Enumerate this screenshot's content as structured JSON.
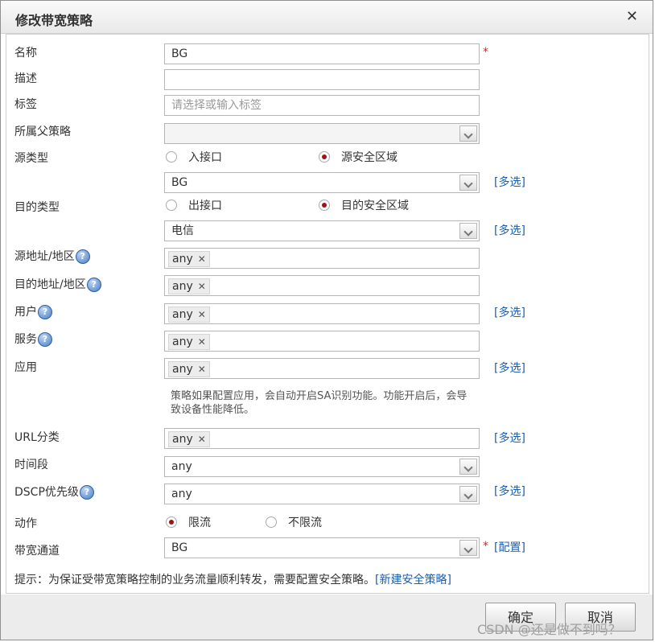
{
  "dialog": {
    "title": "修改带宽策略",
    "close_symbol": "✕"
  },
  "fields": {
    "name": {
      "label": "名称",
      "value": "BG",
      "required_mark": "*"
    },
    "description": {
      "label": "描述",
      "value": ""
    },
    "tags": {
      "label": "标签",
      "placeholder": "请选择或输入标签"
    },
    "parent_policy": {
      "label": "所属父策略",
      "value": ""
    },
    "source_type": {
      "label": "源类型",
      "options": [
        "入接口",
        "源安全区域"
      ],
      "selected": "源安全区域",
      "select_value": "BG",
      "multi_link": "[多选]"
    },
    "dest_type": {
      "label": "目的类型",
      "options": [
        "出接口",
        "目的安全区域"
      ],
      "selected": "目的安全区域",
      "select_value": "电信",
      "multi_link": "[多选]"
    },
    "source_addr": {
      "label": "源地址/地区",
      "tag": "any"
    },
    "dest_addr": {
      "label": "目的地址/地区",
      "tag": "any"
    },
    "user": {
      "label": "用户",
      "tag": "any",
      "multi_link": "[多选]"
    },
    "service": {
      "label": "服务",
      "tag": "any"
    },
    "application": {
      "label": "应用",
      "tag": "any",
      "multi_link": "[多选]",
      "note": "策略如果配置应用，会自动开启SA识别功能。功能开启后，会导致设备性能降低。"
    },
    "url_category": {
      "label": "URL分类",
      "tag": "any",
      "multi_link": "[多选]"
    },
    "time_range": {
      "label": "时间段",
      "value": "any"
    },
    "dscp_priority": {
      "label": "DSCP优先级",
      "value": "any",
      "multi_link": "[多选]"
    },
    "action": {
      "label": "动作",
      "options": [
        "限流",
        "不限流"
      ],
      "selected": "限流"
    },
    "bandwidth_channel": {
      "label": "带宽通道",
      "value": "BG",
      "required_mark": "*",
      "config_link": "[配置]"
    }
  },
  "help_symbol": "?",
  "tag_remove_symbol": "✕",
  "hint": {
    "text": "提示：为保证受带宽策略控制的业务流量顺利转发，需要配置安全策略。",
    "link": "[新建安全策略]"
  },
  "buttons": {
    "ok": "确定",
    "cancel": "取消"
  },
  "watermark": "CSDN @还是做不到吗？",
  "colors": {
    "link": "#1b5fb0",
    "required": "#e2231a",
    "radio_selected": "#a31212"
  }
}
